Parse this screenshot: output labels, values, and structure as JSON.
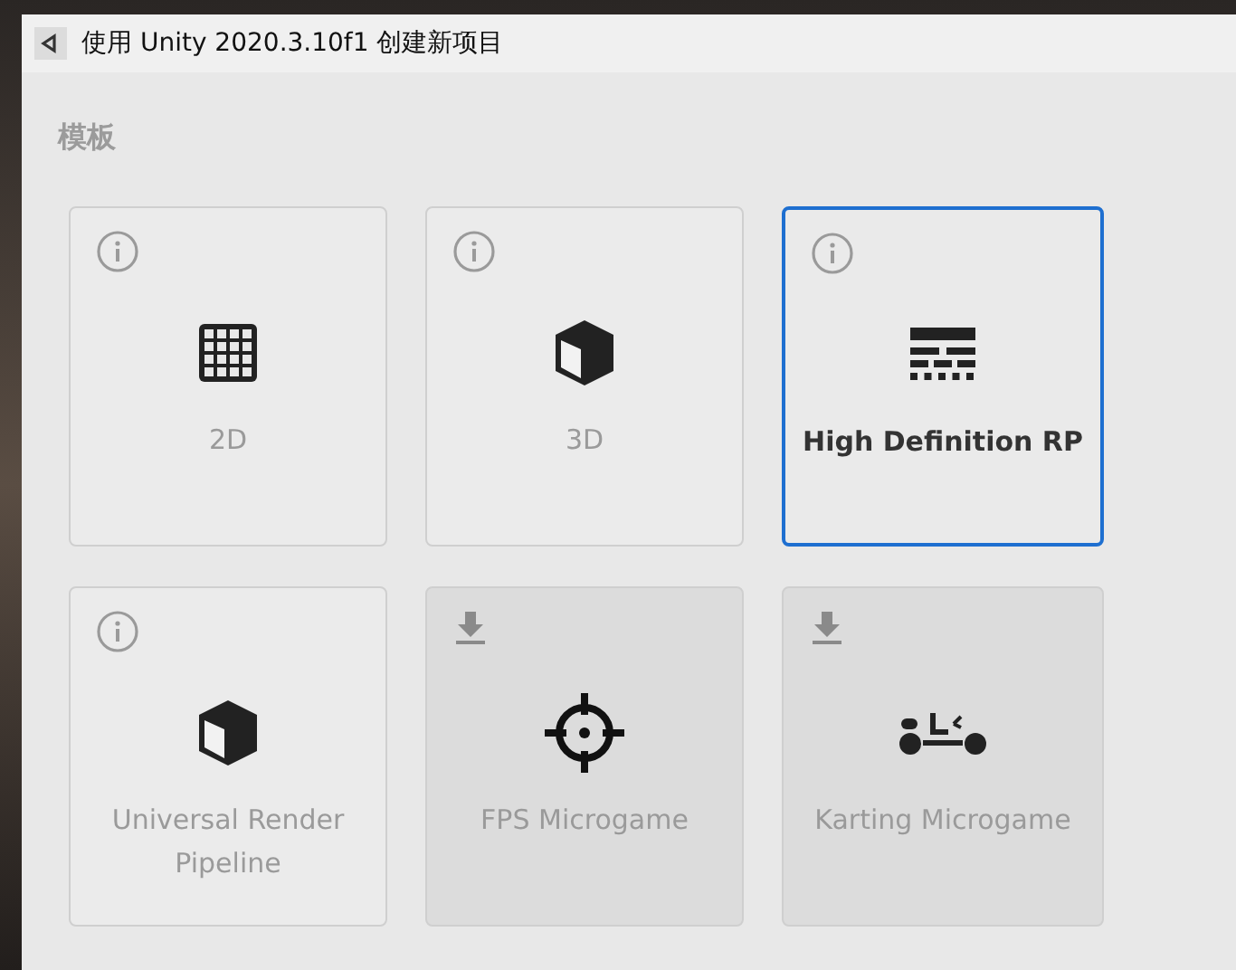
{
  "window": {
    "title": "使用 Unity 2020.3.10f1 创建新项目"
  },
  "section_title": "模板",
  "templates": [
    {
      "label": "2D",
      "kind": "info",
      "selected": false
    },
    {
      "label": "3D",
      "kind": "info",
      "selected": false
    },
    {
      "label": "High Definition RP",
      "kind": "info",
      "selected": true
    },
    {
      "label": "Universal Render Pipeline",
      "kind": "info",
      "selected": false
    },
    {
      "label": "FPS Microgame",
      "kind": "download",
      "selected": false
    },
    {
      "label": "Karting Microgame",
      "kind": "download",
      "selected": false
    }
  ]
}
